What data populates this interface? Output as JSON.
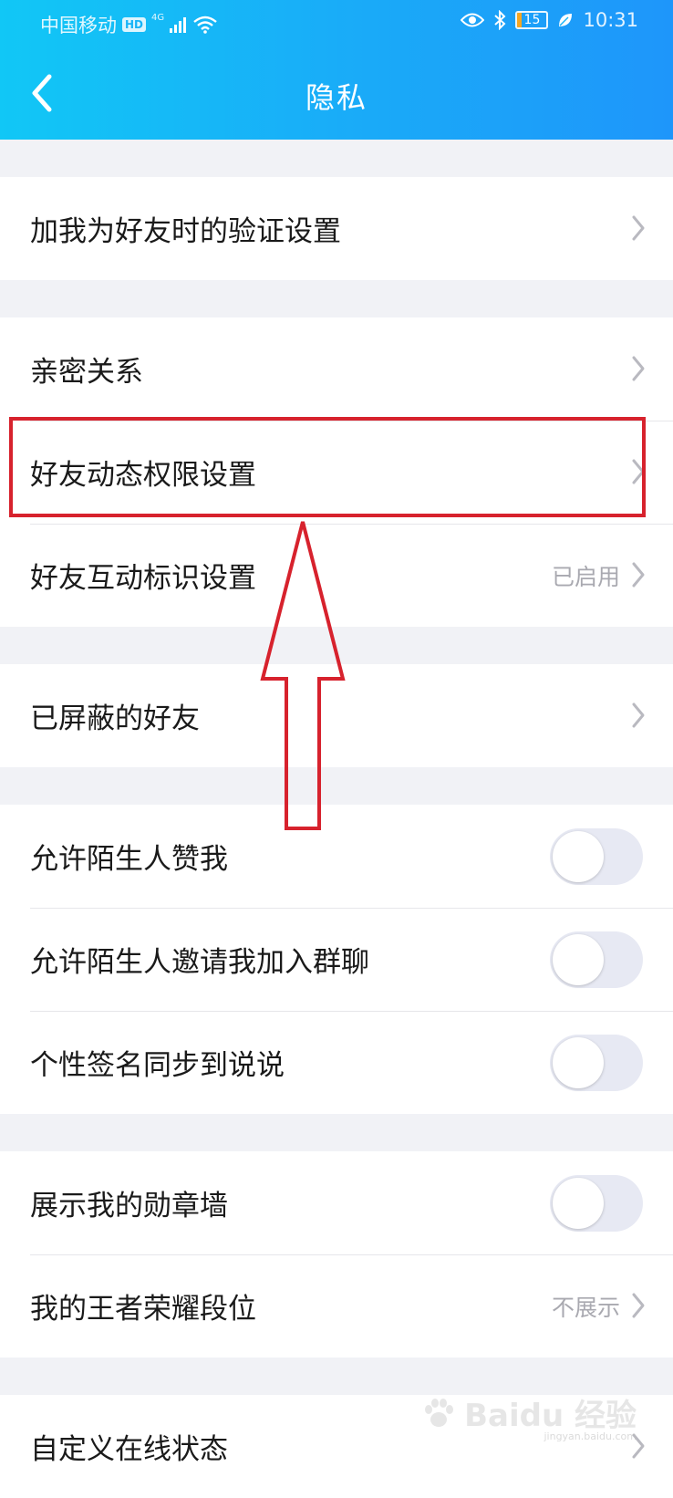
{
  "status": {
    "carrier": "中国移动",
    "hd": "HD",
    "network": "4G",
    "battery": "15",
    "battery_level_percent": 15,
    "time": "10:31"
  },
  "header": {
    "title": "隐私"
  },
  "groups": {
    "g1": {
      "verify": "加我为好友时的验证设置"
    },
    "g2": {
      "intimacy": "亲密关系",
      "feed_permission": "好友动态权限设置",
      "interaction_marks": "好友互动标识设置",
      "interaction_marks_value": "已启用"
    },
    "g3": {
      "blocked": "已屏蔽的好友"
    },
    "g4": {
      "allow_like": "允许陌生人赞我",
      "allow_like_on": false,
      "allow_invite": "允许陌生人邀请我加入群聊",
      "allow_invite_on": false,
      "signature_sync": "个性签名同步到说说",
      "signature_sync_on": false
    },
    "g5": {
      "badge_wall": "展示我的勋章墙",
      "badge_wall_on": false,
      "honor_rank": "我的王者荣耀段位",
      "honor_rank_value": "不展示"
    },
    "g6": {
      "custom_status": "自定义在线状态"
    }
  },
  "watermark": {
    "brand": "Baidu 经验",
    "url": "jingyan.baidu.com"
  },
  "colors": {
    "header_start": "#11c7f6",
    "header_end": "#1e96fa",
    "annotation": "#d7222d"
  }
}
